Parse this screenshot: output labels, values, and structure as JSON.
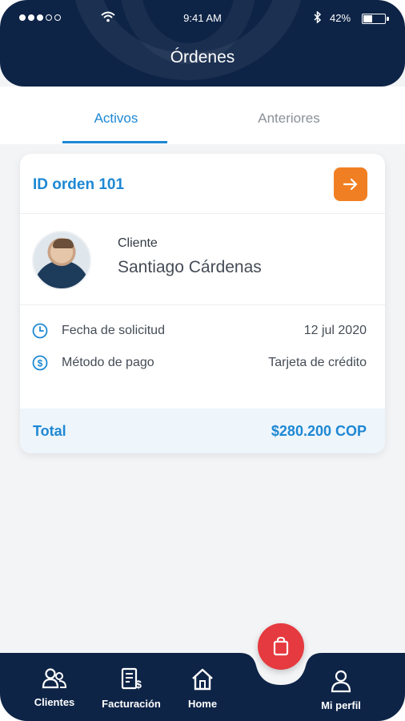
{
  "status_bar": {
    "time": "9:41 AM",
    "battery": "42%",
    "battery_level": 0.42
  },
  "header": {
    "title": "Órdenes"
  },
  "tabs": [
    {
      "label": "Activos",
      "active": true
    },
    {
      "label": "Anteriores",
      "active": false
    }
  ],
  "order": {
    "id_label": "ID orden 101",
    "client_label": "Cliente",
    "client_name": "Santiago Cárdenas",
    "date_label": "Fecha de solicitud",
    "date_value": "12 jul 2020",
    "payment_label": "Método de pago",
    "payment_value": "Tarjeta de crédito",
    "total_label": "Total",
    "total_value": "$280.200 COP"
  },
  "nav": [
    {
      "label": "Clientes",
      "icon": "users-icon"
    },
    {
      "label": "Facturación",
      "icon": "invoice-icon"
    },
    {
      "label": "Home",
      "icon": "home-icon"
    },
    {
      "label": "Mi perfil",
      "icon": "profile-icon"
    }
  ],
  "colors": {
    "primary_dark": "#0e2447",
    "accent_blue": "#1e88d4",
    "arrow_orange": "#f07f23",
    "fab_red": "#e53a3f"
  }
}
